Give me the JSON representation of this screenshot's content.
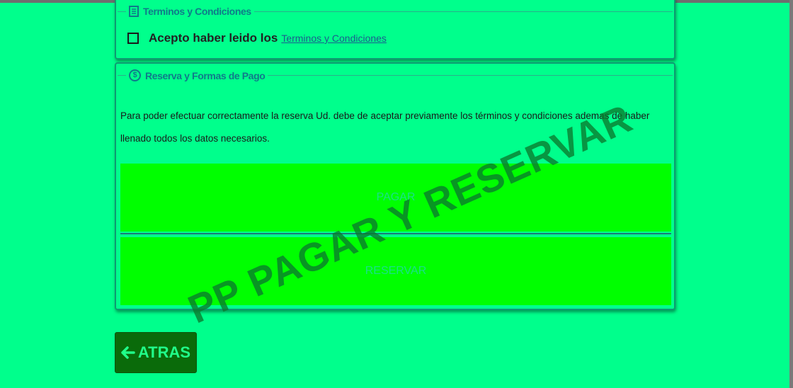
{
  "terms_panel": {
    "legend": "Terminos y Condiciones",
    "legend_icon": "document-icon",
    "accept_label": "Acepto haber leido los",
    "terms_link": "Terminos y Condiciones",
    "accepted": false
  },
  "payment_panel": {
    "legend": "Reserva y Formas de Pago",
    "legend_icon": "dollar-circle-icon",
    "legend_icon_glyph": "$",
    "description": "Para poder efectuar correctamente la reserva Ud. debe de aceptar previamente los términos y condiciones ademas de haber llenado todos los datos necesarios.",
    "pay_button": "PAGAR",
    "reserve_button": "RESERVAR"
  },
  "watermark": "PP PAGAR Y RESERVAR",
  "back_button": {
    "label": "ATRAS",
    "icon": "arrow-left-icon"
  },
  "colors": {
    "page_background": "#00ff8c",
    "button_background": "#00ff00",
    "back_button_background": "#0a6b0a",
    "legend_text": "#107a8a"
  }
}
